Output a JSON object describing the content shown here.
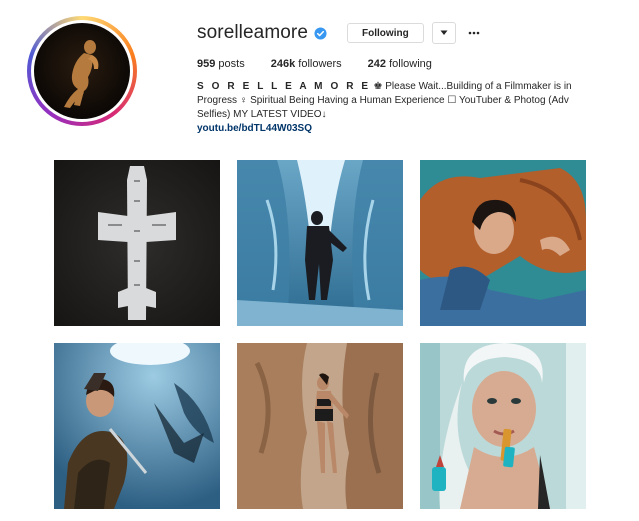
{
  "profile": {
    "username": "sorelleamore",
    "follow_button_label": "Following",
    "stats": {
      "posts_count": "959",
      "posts_label": "posts",
      "followers_count": "246k",
      "followers_label": "followers",
      "following_count": "242",
      "following_label": "following"
    },
    "bio": {
      "name": "S O R E L L E A M O R E",
      "text": " ♚ Please Wait...Building of a Filmmaker is in Progress ♀ Spiritual Being Having a Human Experience ☐ YouTuber & Photog (Adv Selfies) MY LATEST VIDEO↓",
      "link": "youtu.be/bdTL44W03SQ"
    }
  },
  "icons": {
    "verified": "verified-badge-icon",
    "caret": "chevron-down-icon",
    "more": "more-options-icon"
  },
  "colors": {
    "verified_blue": "#3897f0",
    "link": "#003569",
    "border": "#dbdbdb",
    "text": "#262626"
  },
  "posts": [
    {
      "subject": "plane wreck on black sand"
    },
    {
      "subject": "person in ice cave"
    },
    {
      "subject": "woman in denim on leather chair"
    },
    {
      "subject": "woman in ice cave with ice axe"
    },
    {
      "subject": "woman standing in canyon rocks"
    },
    {
      "subject": "woman with towel applying lipstick"
    }
  ]
}
